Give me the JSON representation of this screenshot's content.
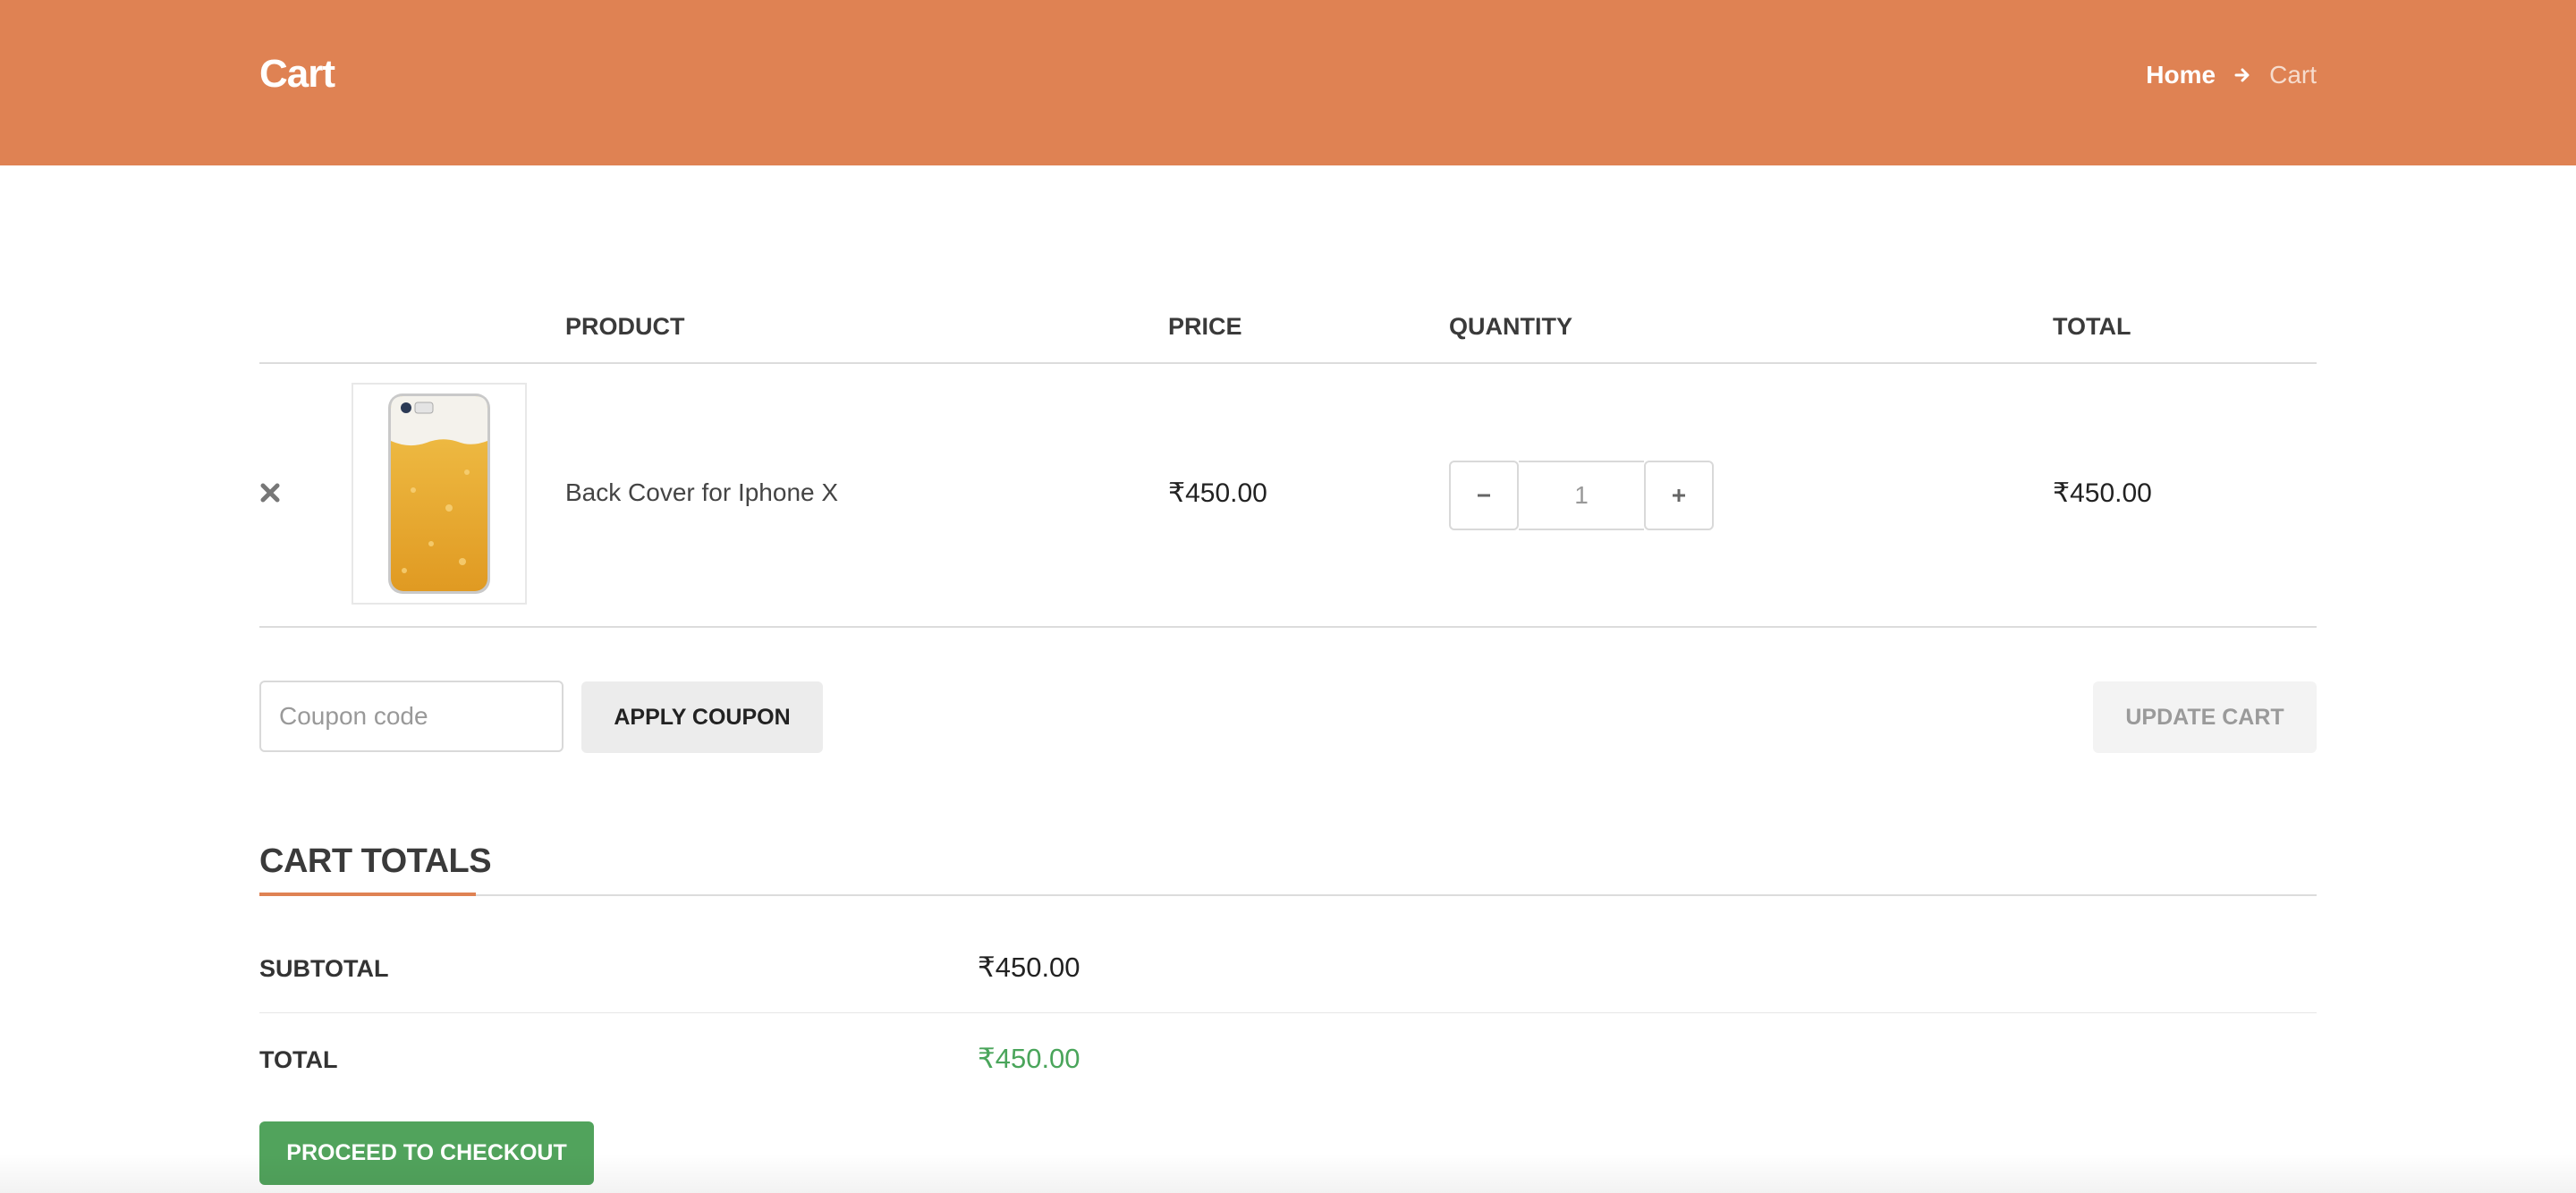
{
  "header": {
    "title": "Cart",
    "breadcrumb": {
      "home": "Home",
      "current": "Cart",
      "separator_icon": "arrow-right-icon"
    },
    "background_color": "#df8253"
  },
  "table": {
    "columns": [
      "PRODUCT",
      "PRICE",
      "QUANTITY",
      "TOTAL"
    ],
    "items": [
      {
        "remove_icon": "close-x-icon",
        "image": "phone-case-beer-thumbnail",
        "name": "Back Cover for Iphone X",
        "price": "₹450.00",
        "quantity": "1",
        "total": "₹450.00"
      }
    ]
  },
  "coupon": {
    "placeholder": "Coupon code",
    "apply_label": "APPLY COUPON"
  },
  "update_label": "UPDATE CART",
  "totals": {
    "title": "CART TOTALS",
    "subtotal_label": "SUBTOTAL",
    "subtotal_value": "₹450.00",
    "total_label": "TOTAL",
    "total_value": "₹450.00",
    "total_color": "#4aa55b"
  },
  "checkout_label": "PROCEED TO CHECKOUT"
}
